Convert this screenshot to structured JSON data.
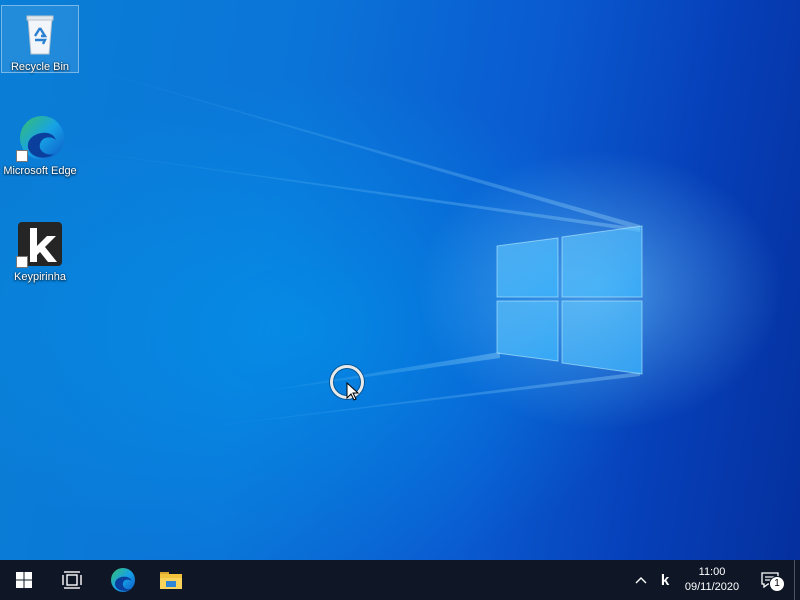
{
  "desktop": {
    "icons": [
      {
        "label": "Recycle Bin"
      },
      {
        "label": "Microsoft Edge"
      },
      {
        "label": "Keypirinha"
      }
    ]
  },
  "taskbar": {
    "tray": {
      "keypirinha_glyph": "k",
      "chevron_glyph": "^"
    },
    "clock": {
      "time": "11:00",
      "date": "09/11/2020"
    },
    "notification_count": "1"
  },
  "icons": {
    "start": "windows-logo-icon",
    "task_view": "task-view-icon",
    "edge": "edge-icon",
    "explorer": "file-explorer-icon",
    "notifications": "action-center-icon"
  },
  "colors": {
    "taskbar": "#0f1726",
    "desktop_blue": "#0b74d8"
  }
}
